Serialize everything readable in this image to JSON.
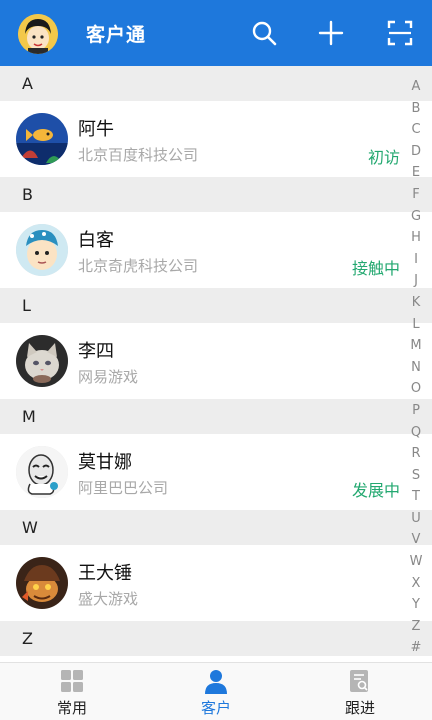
{
  "header": {
    "title": "客户通",
    "icons": [
      "avatar",
      "search-icon",
      "plus-icon",
      "scan-icon"
    ]
  },
  "sections": [
    {
      "letter": "A",
      "name": "阿牛",
      "company": "北京百度科技公司",
      "stage": "初访",
      "avatar": "fish-aquarium"
    },
    {
      "letter": "B",
      "name": "白客",
      "company": "北京奇虎科技公司",
      "stage": "接触中",
      "avatar": "cartoon-boy-bandana"
    },
    {
      "letter": "L",
      "name": "李四",
      "company": "网易游戏",
      "stage": "",
      "avatar": "cat"
    },
    {
      "letter": "M",
      "name": "莫甘娜",
      "company": "阿里巴巴公司",
      "stage": "发展中",
      "avatar": "meme-face"
    },
    {
      "letter": "W",
      "name": "王大锤",
      "company": "盛大游戏",
      "stage": "",
      "avatar": "game-character"
    },
    {
      "letter": "Z",
      "name": "",
      "company": "",
      "stage": "",
      "avatar": ""
    }
  ],
  "index": [
    "A",
    "B",
    "C",
    "D",
    "E",
    "F",
    "G",
    "H",
    "I",
    "J",
    "K",
    "L",
    "M",
    "N",
    "O",
    "P",
    "Q",
    "R",
    "S",
    "T",
    "U",
    "V",
    "W",
    "X",
    "Y",
    "Z",
    "#"
  ],
  "tabs": [
    {
      "label": "常用",
      "icon": "grid-icon",
      "active": false
    },
    {
      "label": "客户",
      "icon": "person-icon",
      "active": true
    },
    {
      "label": "跟进",
      "icon": "document-search-icon",
      "active": false
    }
  ],
  "colors": {
    "primary": "#1e78dc",
    "stage": "#23a870",
    "muted": "#a8a8a8"
  }
}
